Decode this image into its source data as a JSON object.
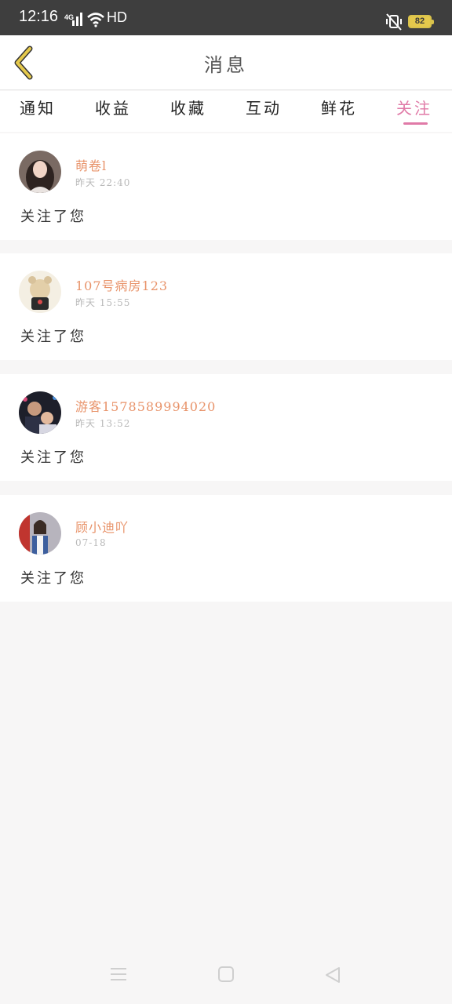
{
  "status_bar": {
    "time": "12:16",
    "network": "4G",
    "hd": "HD",
    "battery": "82"
  },
  "header": {
    "title": "消息",
    "back_icon": "chevron-left-icon"
  },
  "tabs": [
    {
      "label": "通知",
      "active": false
    },
    {
      "label": "收益",
      "active": false
    },
    {
      "label": "收藏",
      "active": false
    },
    {
      "label": "互动",
      "active": false
    },
    {
      "label": "鲜花",
      "active": false
    },
    {
      "label": "关注",
      "active": true
    }
  ],
  "messages": [
    {
      "name": "萌卷l",
      "time": "昨天 22:40",
      "text": "关注了您"
    },
    {
      "name": "107号病房123",
      "time": "昨天 15:55",
      "text": "关注了您"
    },
    {
      "name": "游客1578589994020",
      "time": "昨天 13:52",
      "text": "关注了您"
    },
    {
      "name": "顾小迪吖",
      "time": "07-18",
      "text": "关注了您"
    }
  ],
  "colors": {
    "accent": "#e07aa7",
    "username": "#e8936a",
    "back_icon": "#e5c94c"
  },
  "nav": {
    "menu_icon": "menu-icon",
    "home_icon": "home-square-icon",
    "back_icon": "back-triangle-icon"
  }
}
